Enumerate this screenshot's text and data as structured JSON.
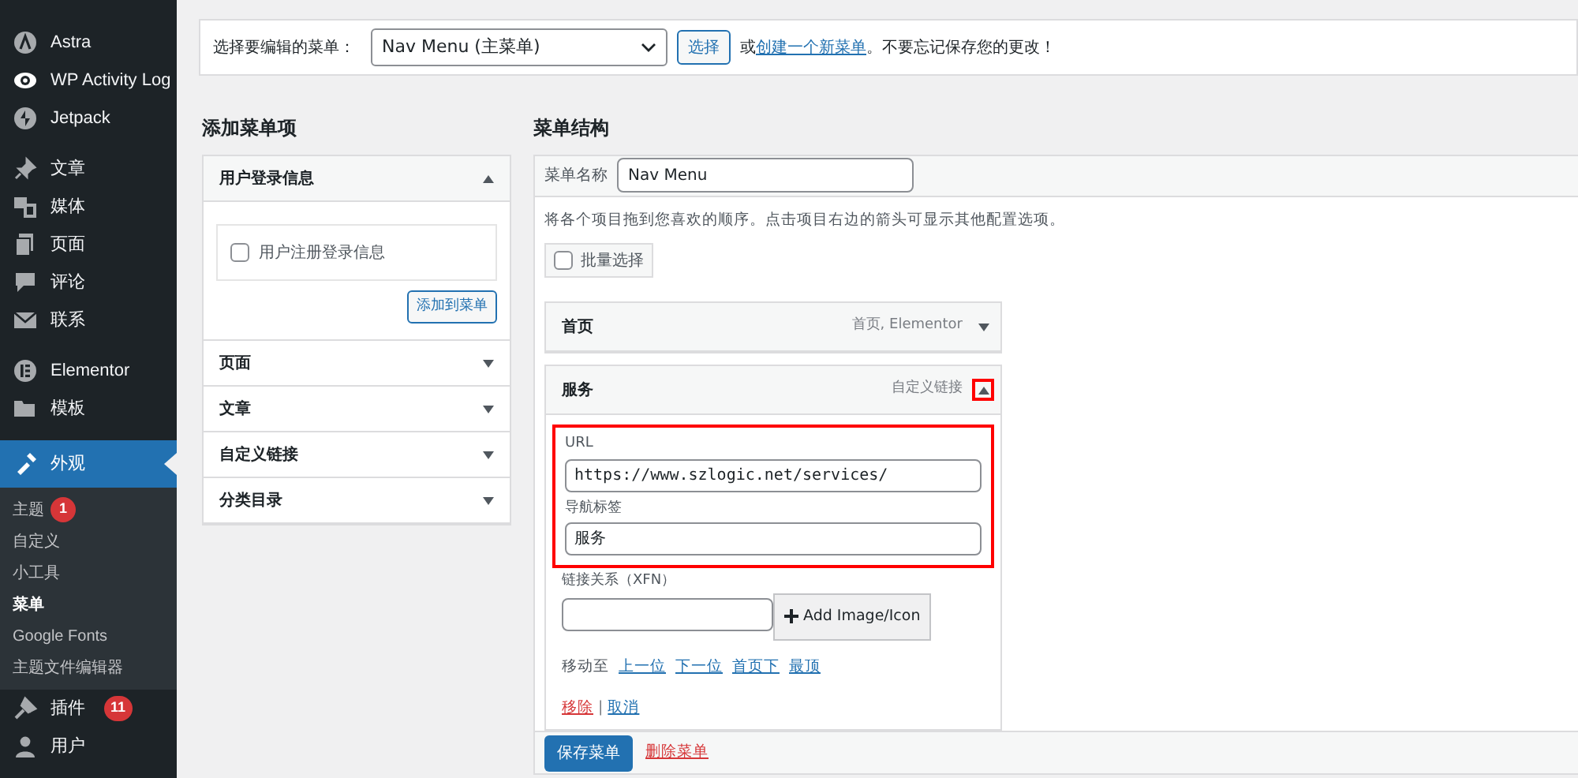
{
  "sidebar": {
    "items": [
      {
        "label": "Astra",
        "selected": false
      },
      {
        "label": "WP Activity Log",
        "selected": false
      },
      {
        "label": "Jetpack",
        "selected": false,
        "group_end": true
      },
      {
        "label": "文章",
        "selected": false
      },
      {
        "label": "媒体",
        "selected": false
      },
      {
        "label": "页面",
        "selected": false
      },
      {
        "label": "评论",
        "selected": false
      },
      {
        "label": "联系",
        "selected": false,
        "group_end": true
      },
      {
        "label": "Elementor",
        "selected": false
      },
      {
        "label": "模板",
        "selected": false,
        "group_end": true
      },
      {
        "label": "外观",
        "selected": true,
        "children": [
          {
            "label": "主题",
            "badge": "1",
            "selected": false
          },
          {
            "label": "自定义",
            "selected": false
          },
          {
            "label": "小工具",
            "selected": false
          },
          {
            "label": "菜单",
            "selected": true
          },
          {
            "label": "Google Fonts",
            "selected": false
          },
          {
            "label": "主题文件编辑器",
            "selected": false
          }
        ]
      },
      {
        "label": "插件",
        "badge": "11",
        "selected": false
      },
      {
        "label": "用户",
        "selected": false
      }
    ]
  },
  "menu_select": {
    "label": "选择要编辑的菜单：",
    "value": "Nav Menu (主菜单)",
    "button": "选择",
    "prefix": "或",
    "link": "创建一个新菜单",
    "suffix": "。不要忘记保存您的更改！"
  },
  "add_items": {
    "title": "添加菜单项",
    "sections": [
      {
        "title": "用户登录信息",
        "expanded": true,
        "options": [
          {
            "label": "用户注册登录信息",
            "checked": false
          }
        ],
        "button": "添加到菜单"
      },
      {
        "title": "页面",
        "expanded": false
      },
      {
        "title": "文章",
        "expanded": false
      },
      {
        "title": "自定义链接",
        "expanded": false
      },
      {
        "title": "分类目录",
        "expanded": false
      }
    ]
  },
  "structure": {
    "title": "菜单结构",
    "name_label": "菜单名称",
    "name_value": "Nav Menu",
    "hint": "将各个项目拖到您喜欢的顺序。点击项目右边的箭头可显示其他配置选项。",
    "bulk_select": {
      "label": "批量选择",
      "checked": false
    },
    "items": [
      {
        "title": "首页",
        "type": "首页, Elementor",
        "expanded": false
      },
      {
        "title": "服务",
        "type": "自定义链接",
        "expanded": true,
        "highlighted": true,
        "url_label": "URL",
        "url": "https://www.szlogic.net/services/",
        "nav_label": "导航标签",
        "nav_value": "服务",
        "xfn_label": "链接关系（XFN）",
        "image_button": "Add Image/Icon",
        "move_label": "移动至",
        "move_links": [
          "上一位",
          "下一位",
          "首页下",
          "最顶"
        ],
        "remove": "移除",
        "separator": "|",
        "cancel": "取消"
      }
    ],
    "save": "保存菜单",
    "delete": "删除菜单"
  }
}
